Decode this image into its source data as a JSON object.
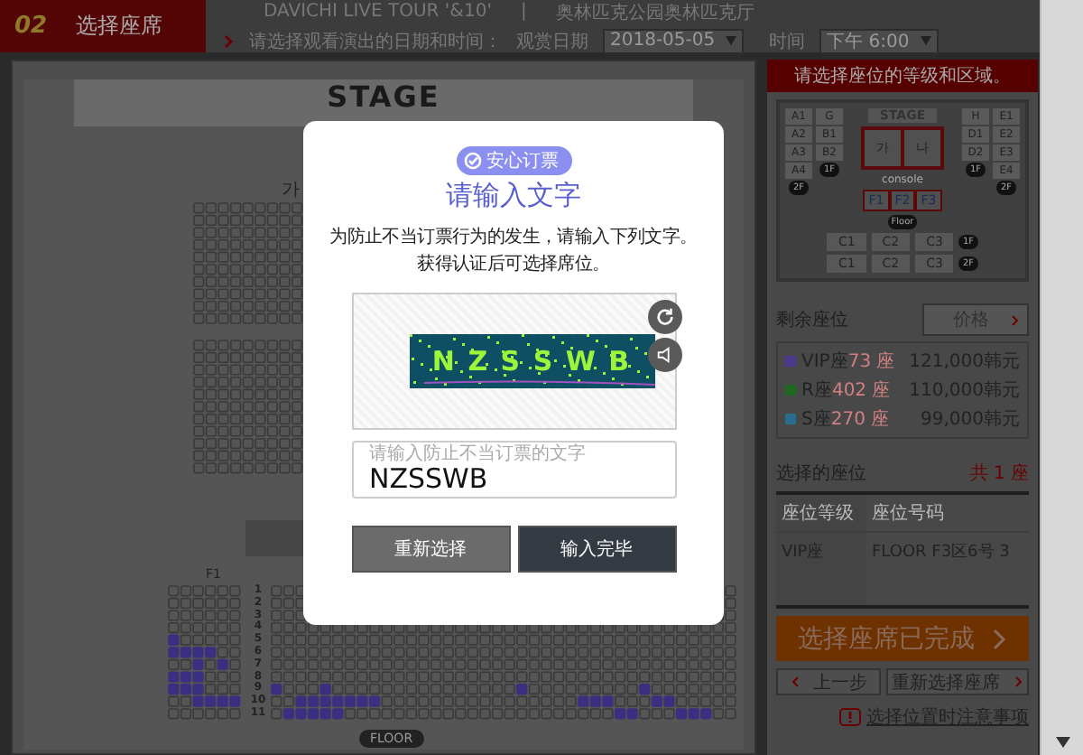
{
  "header": {
    "step_number": "02",
    "step_title": "选择座席",
    "event": "DAVICHI LIVE TOUR '&10'",
    "separator": "|",
    "venue": "奥林匹克公园奥林匹克厅",
    "prompt": "请选择观看演出的日期和时间：",
    "date_label": "观赏日期",
    "date_value": "2018-05-05",
    "time_label": "时间",
    "time_value": "下午 6:00"
  },
  "seat_map": {
    "stage": "STAGE",
    "upper_section": "가",
    "lower_section": "F1",
    "row_numbers": [
      "1",
      "2",
      "3",
      "4",
      "5",
      "6",
      "7",
      "8",
      "9",
      "10",
      "11"
    ],
    "floor_label": "FLOOR"
  },
  "sidebar": {
    "banner": "请选择座位的等级和区域。",
    "minimap": {
      "stage": "STAGE",
      "far_left": {
        "blocks": [
          "A1",
          "A2",
          "A3",
          "A4"
        ],
        "badge": "2F"
      },
      "left": {
        "blocks": [
          "G",
          "B1",
          "B2"
        ],
        "badge": "1F"
      },
      "center": [
        "가",
        "나"
      ],
      "console": "console",
      "floor_blocks": [
        "F1",
        "F2",
        "F3"
      ],
      "floor": "Floor",
      "right": {
        "blocks": [
          "H",
          "D1",
          "D2"
        ],
        "badge": "1F"
      },
      "far_right": {
        "blocks": [
          "E1",
          "E2",
          "E3",
          "E4"
        ],
        "badge": "2F"
      },
      "tiers": [
        {
          "blocks": [
            "C1",
            "C2",
            "C3"
          ],
          "badge": "1F"
        },
        {
          "blocks": [
            "C1",
            "C2",
            "C3"
          ],
          "badge": "2F"
        }
      ]
    },
    "remaining_title": "剩余座位",
    "price_button": "价格",
    "grades": [
      {
        "name": "VIP座",
        "count": "73 座",
        "price": "121,000韩元",
        "color": "#4b3a8c"
      },
      {
        "name": "R座",
        "count": "402 座",
        "price": "110,000韩元",
        "color": "#1f6a1f"
      },
      {
        "name": "S座",
        "count": "270 座",
        "price": "99,000韩元",
        "color": "#2a6d8c"
      }
    ],
    "selected_title": "选择的座位",
    "selected_total": "共 1 座",
    "table": {
      "columns": [
        "座位等级",
        "座位号码"
      ],
      "rows": [
        [
          "VIP座",
          "FLOOR F3区6号 3"
        ]
      ]
    },
    "complete_button": "选择座席已完成",
    "prev_button": "上一步",
    "reselect_button": "重新选择座席",
    "notice_link": "选择位置时注意事项"
  },
  "dialog": {
    "badge": "安心订票",
    "title": "请输入文字",
    "description": [
      "为防止不当订票行为的发生，请输入下列文字。",
      "获得认证后可选择席位。"
    ],
    "captcha": "N Z S S W B",
    "input": {
      "label": "请输入防止不当订票的文字",
      "value": "NZSSWB"
    },
    "buttons": [
      {
        "label": "重新选择",
        "kind": "secondary"
      },
      {
        "label": "输入完毕",
        "kind": "primary"
      }
    ]
  }
}
